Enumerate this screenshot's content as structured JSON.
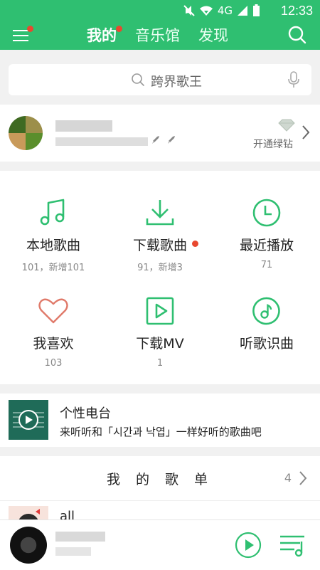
{
  "status_bar": {
    "network": "4G",
    "time": "12:33"
  },
  "header": {
    "tabs": [
      {
        "label": "我的",
        "active": true,
        "badge": true
      },
      {
        "label": "音乐馆",
        "active": false
      },
      {
        "label": "发现",
        "active": false
      }
    ],
    "menu_badge": true
  },
  "search": {
    "placeholder": "跨界歌王"
  },
  "user": {
    "vip_label": "开通绿钻"
  },
  "grid": [
    {
      "icon": "music-note-icon",
      "label": "本地歌曲",
      "sub": "101，新增101"
    },
    {
      "icon": "download-icon",
      "label": "下载歌曲",
      "sub": "91，新增3",
      "badge": true
    },
    {
      "icon": "clock-icon",
      "label": "最近播放",
      "sub": "71"
    },
    {
      "icon": "heart-icon",
      "label": "我喜欢",
      "sub": "103"
    },
    {
      "icon": "video-icon",
      "label": "下载MV",
      "sub": "1"
    },
    {
      "icon": "music-recognize-icon",
      "label": "听歌识曲",
      "sub": ""
    }
  ],
  "radio": {
    "title": "个性电台",
    "subtitle": "来听听和「시간과 낙엽」一样好听的歌曲吧"
  },
  "playlists": {
    "title": "我 的 歌 单",
    "count": "4",
    "items": [
      {
        "name": "all"
      }
    ]
  },
  "colors": {
    "brand": "#2fbf71",
    "badge": "#e8482f",
    "heart": "#e07a6a"
  }
}
